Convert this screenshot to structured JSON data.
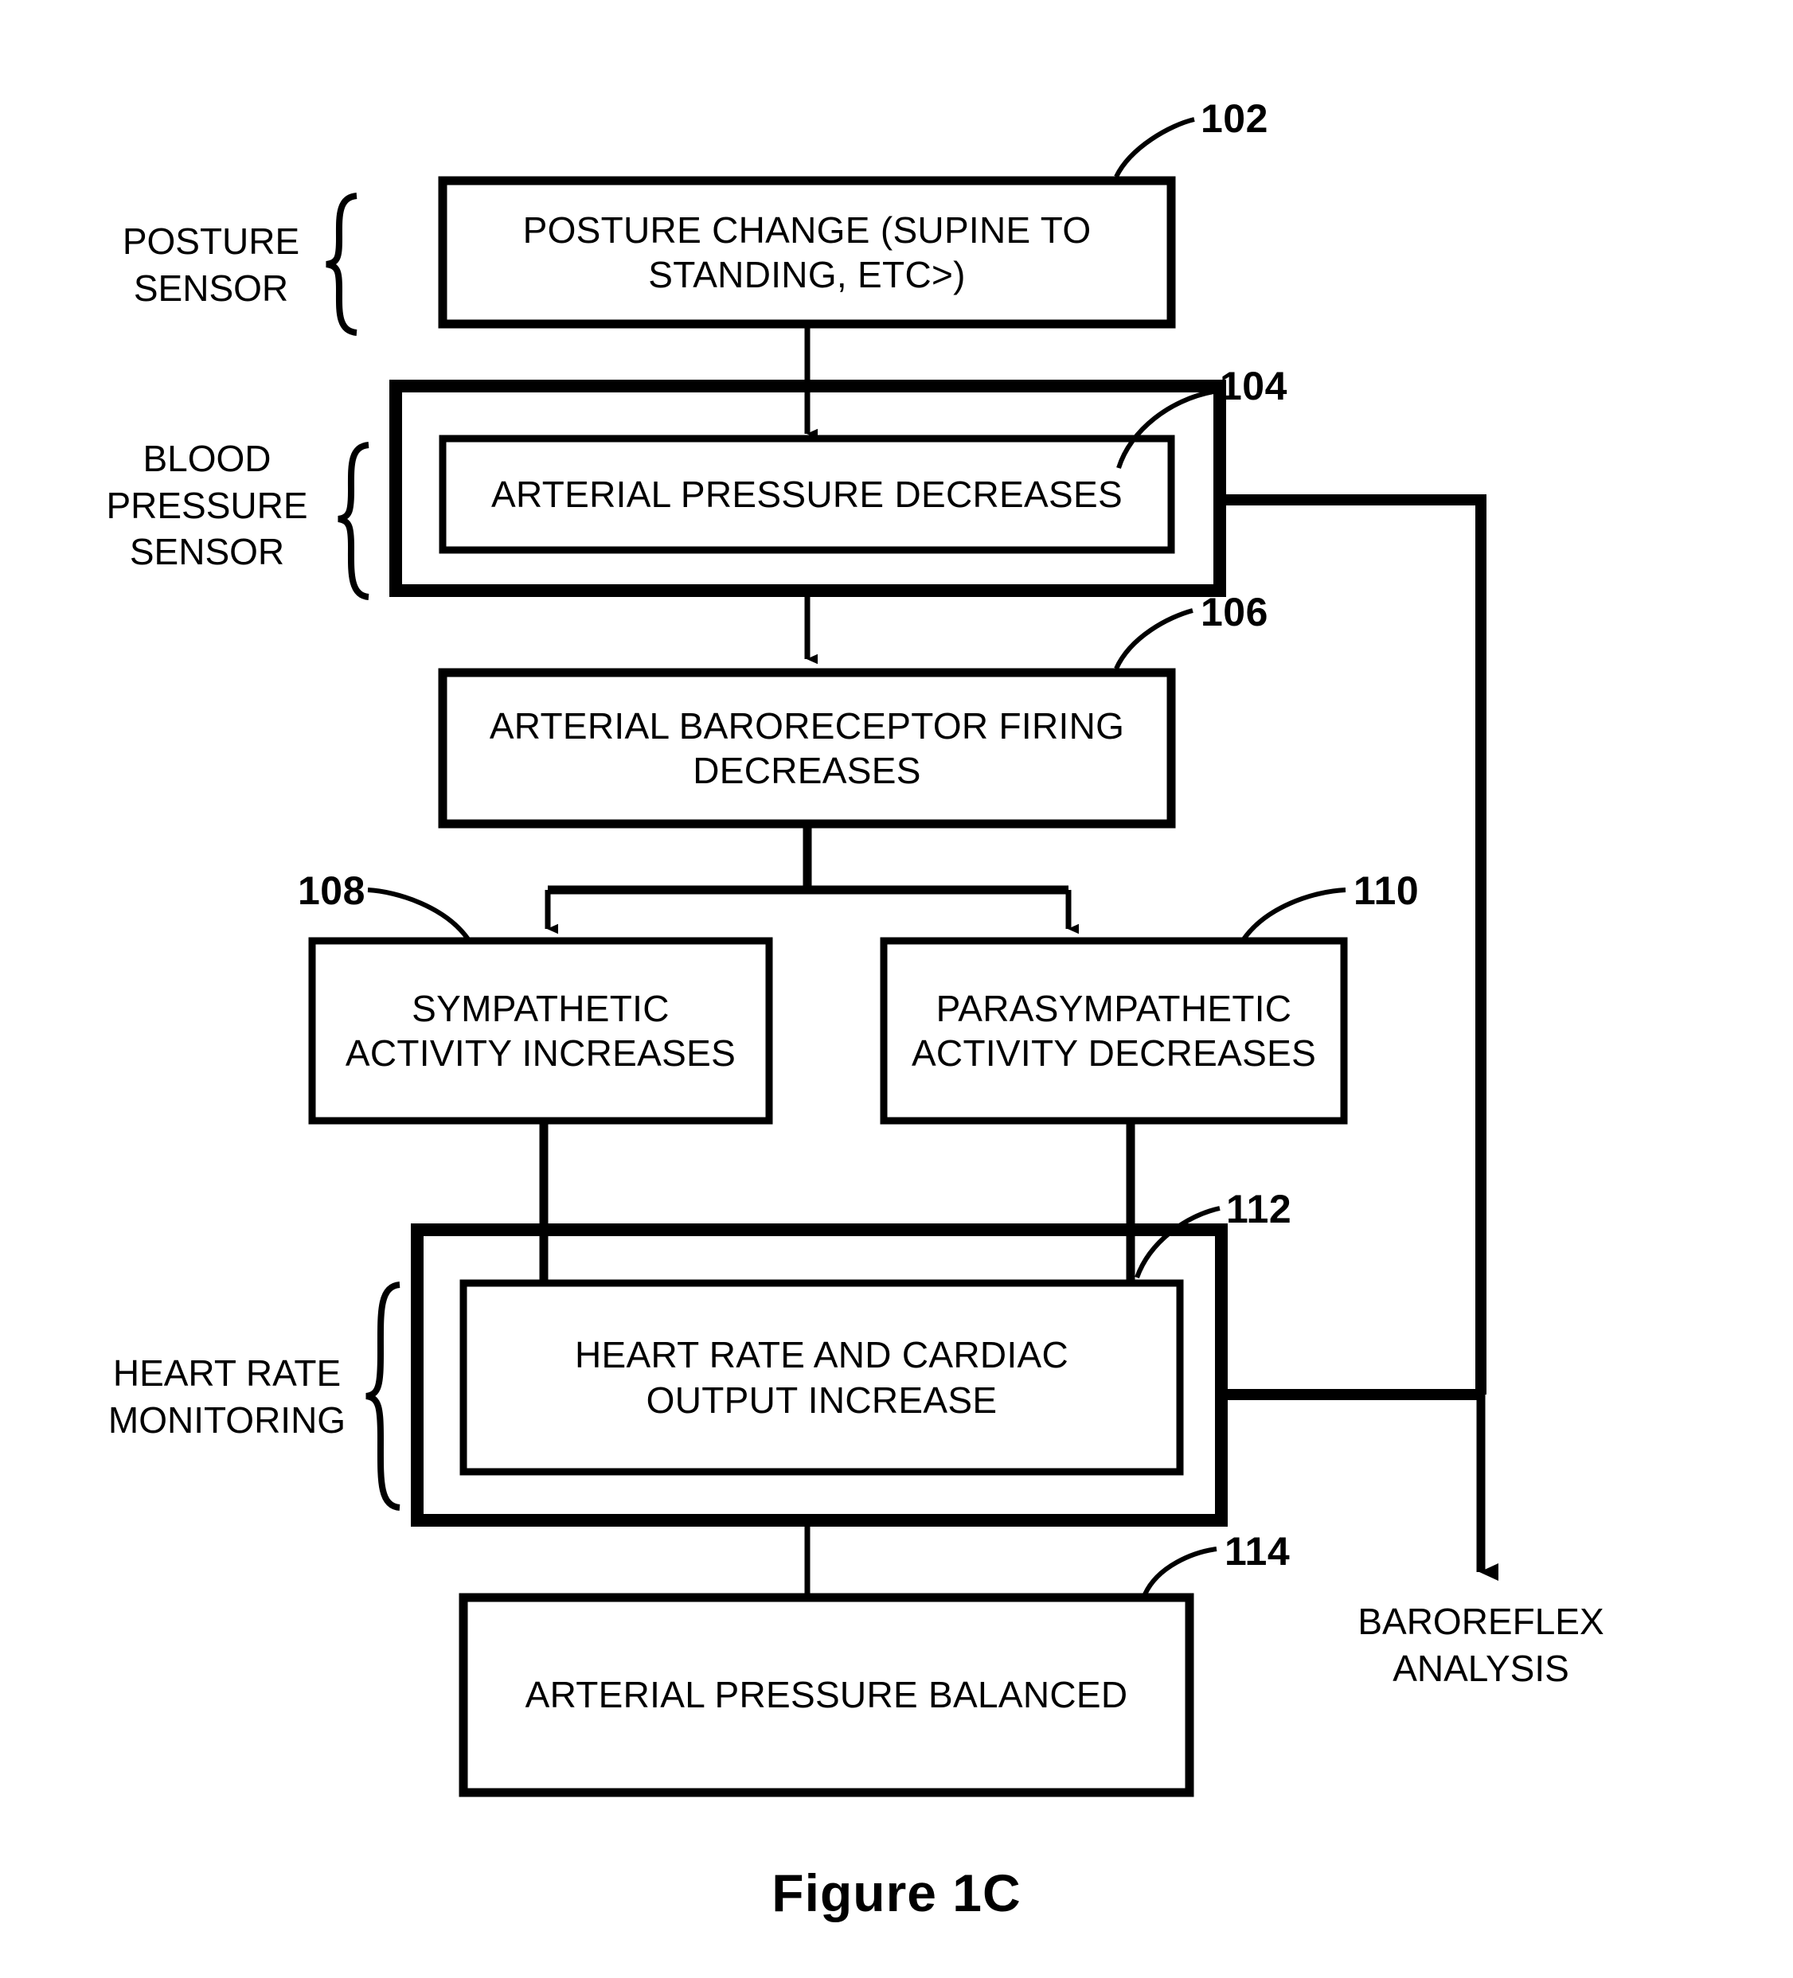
{
  "figure": {
    "caption": "Figure 1C"
  },
  "side_labels": [
    {
      "id": "posture-sensor",
      "text": "POSTURE\nSENSOR"
    },
    {
      "id": "blood-pressure-sensor",
      "text": "BLOOD\nPRESSURE\nSENSOR"
    },
    {
      "id": "heart-rate-monitoring",
      "text": "HEART RATE\nMONITORING"
    }
  ],
  "boxes": [
    {
      "id": "posture-change",
      "ref": "102",
      "text": "POSTURE CHANGE (SUPINE TO\nSTANDING, ETC>)"
    },
    {
      "id": "arterial-pressure-decreases",
      "ref": "104",
      "text": "ARTERIAL PRESSURE DECREASES"
    },
    {
      "id": "baroreceptor-firing-decreases",
      "ref": "106",
      "text": "ARTERIAL BARORECEPTOR FIRING\nDECREASES"
    },
    {
      "id": "sympathetic-activity-increases",
      "ref": "108",
      "text": "SYMPATHETIC\nACTIVITY INCREASES"
    },
    {
      "id": "parasympathetic-activity-decreases",
      "ref": "110",
      "text": "PARASYMPATHETIC\nACTIVITY DECREASES"
    },
    {
      "id": "heart-rate-cardiac-output-increase",
      "ref": "112",
      "text": "HEART RATE AND CARDIAC\nOUTPUT INCREASE"
    },
    {
      "id": "arterial-pressure-balanced",
      "ref": "114",
      "text": "ARTERIAL PRESSURE BALANCED"
    }
  ],
  "ref_numbers": [
    {
      "id": "ref-102",
      "value": "102"
    },
    {
      "id": "ref-104",
      "value": "104"
    },
    {
      "id": "ref-106",
      "value": "106"
    },
    {
      "id": "ref-108",
      "value": "108"
    },
    {
      "id": "ref-110",
      "value": "110"
    },
    {
      "id": "ref-112",
      "value": "112"
    },
    {
      "id": "ref-114",
      "value": "114"
    }
  ],
  "outputs": [
    {
      "id": "baroreflex-analysis",
      "text": "BAROREFLEX\nANALYSIS"
    }
  ],
  "colors": {
    "stroke": "#000000",
    "background": "#ffffff"
  }
}
